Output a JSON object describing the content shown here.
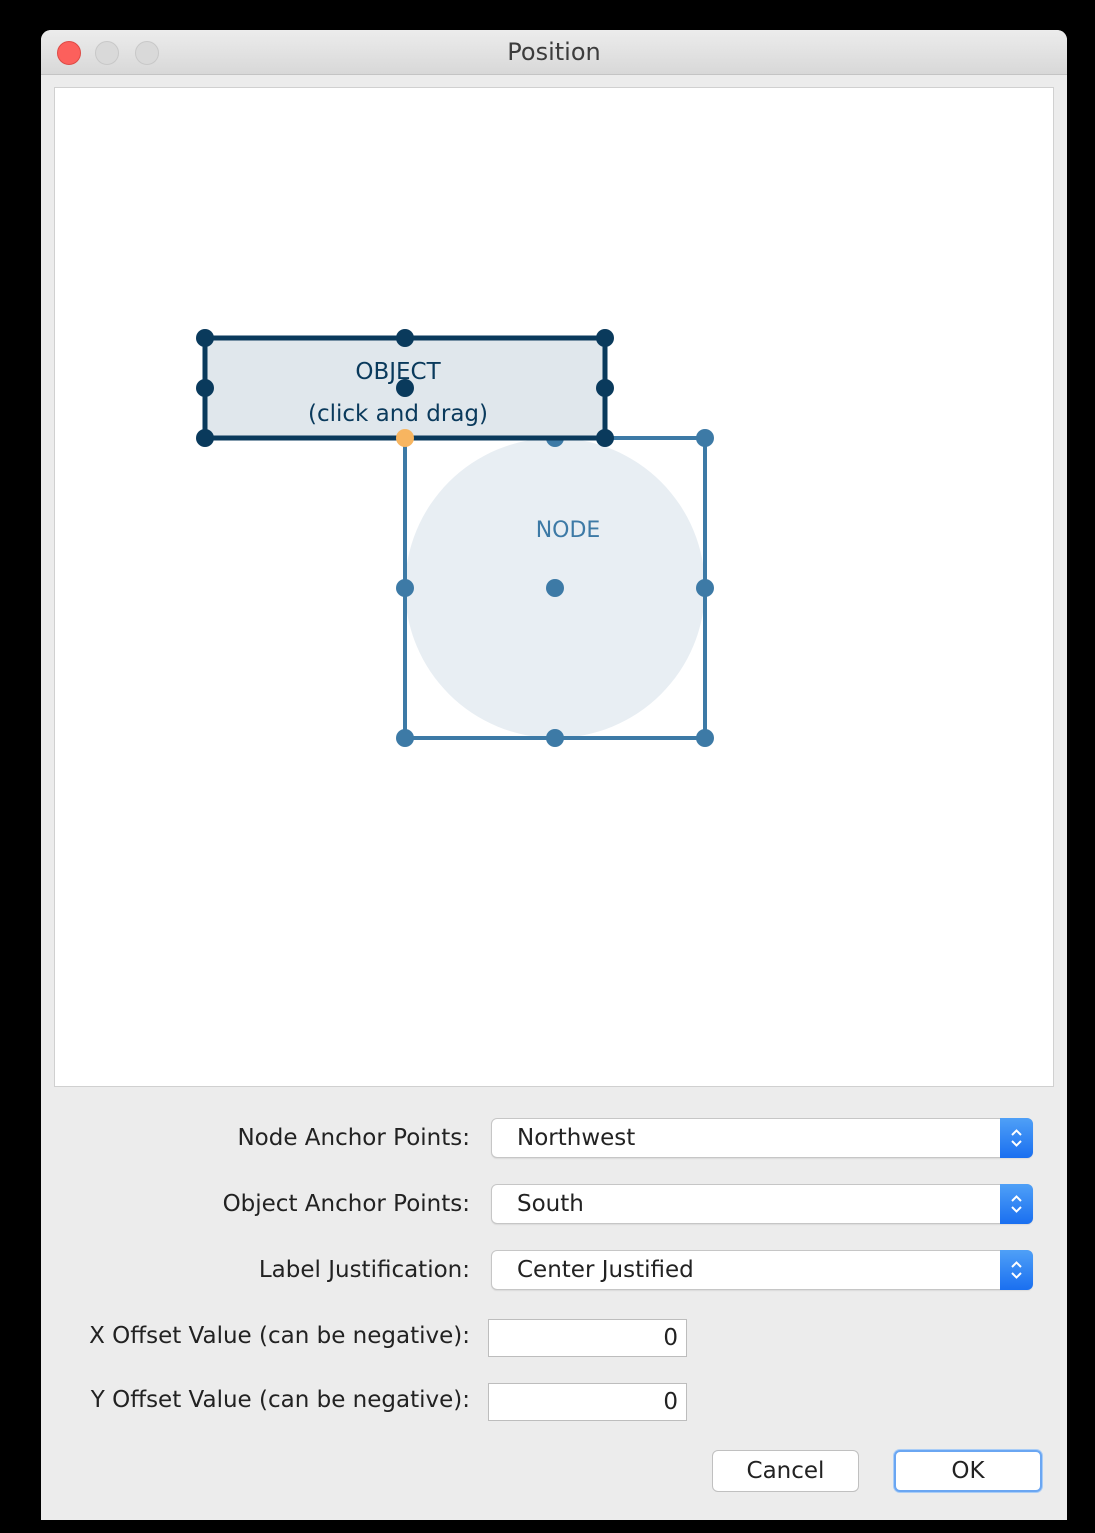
{
  "window": {
    "title": "Position"
  },
  "canvas": {
    "object_label_line1": "OBJECT",
    "object_label_line2": "(click and drag)",
    "node_label": "NODE",
    "colors": {
      "object_stroke": "#0a3a5c",
      "object_fill": "#e0e7ec",
      "node_stroke": "#3d7aa6",
      "node_fill": "#e8eef3",
      "anchor_highlight": "#f7b560"
    }
  },
  "form": {
    "node_anchor": {
      "label": "Node Anchor Points:",
      "value": "Northwest"
    },
    "object_anchor": {
      "label": "Object Anchor Points:",
      "value": "South"
    },
    "label_justification": {
      "label": "Label Justification:",
      "value": "Center Justified"
    },
    "x_offset": {
      "label": "X Offset Value (can be negative):",
      "value": "0"
    },
    "y_offset": {
      "label": "Y Offset Value (can be negative):",
      "value": "0"
    }
  },
  "buttons": {
    "cancel": "Cancel",
    "ok": "OK"
  }
}
